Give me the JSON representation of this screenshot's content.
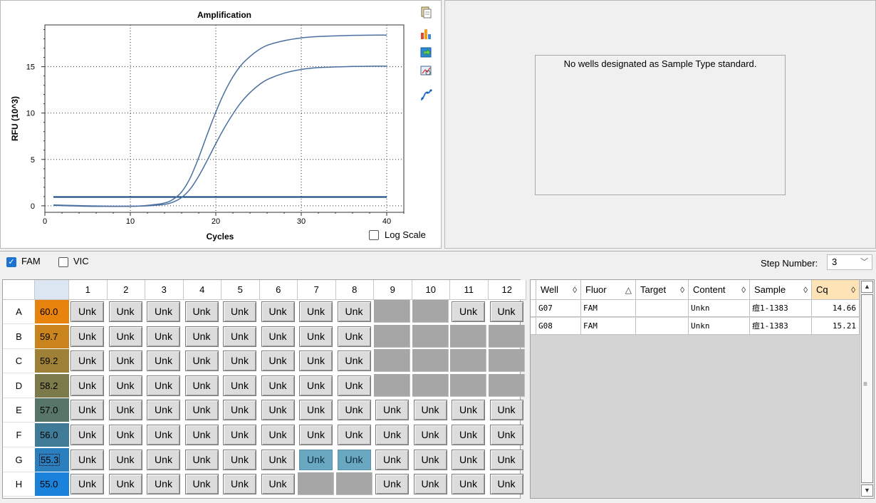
{
  "chart": {
    "title": "Amplification",
    "ylabel": "RFU (10^3)",
    "xlabel": "Cycles",
    "x_ticks": [
      "0",
      "10",
      "20",
      "30",
      "40"
    ],
    "y_ticks": [
      "0",
      "5",
      "10",
      "15"
    ],
    "log_scale_label": "Log Scale",
    "log_scale_checked": false,
    "threshold_color": "#0d3f7a",
    "curve_color": "#4a6fa0"
  },
  "chart_data": {
    "type": "line",
    "title": "Amplification",
    "xlabel": "Cycles",
    "ylabel": "RFU (10^3)",
    "xlim": [
      0,
      42
    ],
    "ylim": [
      -0.7,
      19.5
    ],
    "grid": true,
    "threshold": 0.95,
    "series": [
      {
        "x": [
          1,
          5,
          10,
          12,
          14,
          15,
          16,
          17,
          18,
          19,
          20,
          21,
          22,
          23,
          24,
          25,
          26,
          28,
          30,
          32,
          35,
          38,
          40
        ],
        "values": [
          0.1,
          0.0,
          -0.05,
          0.05,
          0.3,
          0.7,
          1.5,
          3.0,
          5.2,
          7.7,
          10.1,
          12.2,
          13.9,
          15.2,
          16.1,
          16.8,
          17.3,
          17.8,
          18.1,
          18.25,
          18.35,
          18.4,
          18.4
        ]
      },
      {
        "x": [
          1,
          5,
          10,
          12,
          14,
          15,
          16,
          17,
          18,
          19,
          20,
          21,
          22,
          23,
          24,
          25,
          26,
          28,
          30,
          32,
          35,
          38,
          40
        ],
        "values": [
          0.05,
          -0.05,
          -0.05,
          0.0,
          0.15,
          0.4,
          0.9,
          1.8,
          3.2,
          4.9,
          6.7,
          8.4,
          9.9,
          11.2,
          12.2,
          13.0,
          13.6,
          14.3,
          14.7,
          14.9,
          15.0,
          15.05,
          15.05
        ]
      }
    ]
  },
  "standards": {
    "message": "No wells designated as Sample Type standard."
  },
  "fluor": {
    "fam_label": "FAM",
    "fam_checked": true,
    "vic_label": "VIC",
    "vic_checked": false,
    "step_label": "Step Number:",
    "step_value": "3"
  },
  "plate": {
    "columns": [
      "1",
      "2",
      "3",
      "4",
      "5",
      "6",
      "7",
      "8",
      "9",
      "10",
      "11",
      "12"
    ],
    "rows": [
      {
        "label": "A",
        "temp": "60.0",
        "color": "#e8830e",
        "wells": [
          "Unk",
          "Unk",
          "Unk",
          "Unk",
          "Unk",
          "Unk",
          "Unk",
          "Unk",
          "",
          "",
          "Unk",
          "Unk"
        ]
      },
      {
        "label": "B",
        "temp": "59.7",
        "color": "#c9841e",
        "wells": [
          "Unk",
          "Unk",
          "Unk",
          "Unk",
          "Unk",
          "Unk",
          "Unk",
          "Unk",
          "",
          "",
          "",
          ""
        ]
      },
      {
        "label": "C",
        "temp": "59.2",
        "color": "#9e8036",
        "wells": [
          "Unk",
          "Unk",
          "Unk",
          "Unk",
          "Unk",
          "Unk",
          "Unk",
          "Unk",
          "",
          "",
          "",
          ""
        ]
      },
      {
        "label": "D",
        "temp": "58.2",
        "color": "#7c7a4a",
        "wells": [
          "Unk",
          "Unk",
          "Unk",
          "Unk",
          "Unk",
          "Unk",
          "Unk",
          "Unk",
          "",
          "",
          "",
          ""
        ]
      },
      {
        "label": "E",
        "temp": "57.0",
        "color": "#58756a",
        "wells": [
          "Unk",
          "Unk",
          "Unk",
          "Unk",
          "Unk",
          "Unk",
          "Unk",
          "Unk",
          "Unk",
          "Unk",
          "Unk",
          "Unk"
        ]
      },
      {
        "label": "F",
        "temp": "56.0",
        "color": "#3f7a96",
        "wells": [
          "Unk",
          "Unk",
          "Unk",
          "Unk",
          "Unk",
          "Unk",
          "Unk",
          "Unk",
          "Unk",
          "Unk",
          "Unk",
          "Unk"
        ]
      },
      {
        "label": "G",
        "temp": "55.3",
        "color": "#2b7fbf",
        "wells": [
          "Unk",
          "Unk",
          "Unk",
          "Unk",
          "Unk",
          "Unk",
          "Unk",
          "Unk",
          "Unk",
          "Unk",
          "Unk",
          "Unk"
        ]
      },
      {
        "label": "H",
        "temp": "55.0",
        "color": "#1a82da",
        "wells": [
          "Unk",
          "Unk",
          "Unk",
          "Unk",
          "Unk",
          "Unk",
          "",
          "",
          "Unk",
          "Unk",
          "Unk",
          "Unk"
        ]
      }
    ],
    "selected": [
      "G7",
      "G8"
    ],
    "focused_temp_row": "G"
  },
  "results_table": {
    "headers": [
      "Well",
      "Fluor",
      "Target",
      "Content",
      "Sample",
      "Cq"
    ],
    "header_sort": [
      "◊",
      "△",
      "◊",
      "◊",
      "◊",
      "◊"
    ],
    "rows": [
      {
        "well": "G07",
        "fluor": "FAM",
        "target": "",
        "content": "Unkn",
        "sample": "痘1-1383",
        "cq": "14.66"
      },
      {
        "well": "G08",
        "fluor": "FAM",
        "target": "",
        "content": "Unkn",
        "sample": "痘1-1383",
        "cq": "15.21"
      }
    ]
  },
  "icons": [
    "copy-icon",
    "chart-settings-icon",
    "export-icon",
    "zoom-icon",
    "curve-icon"
  ]
}
